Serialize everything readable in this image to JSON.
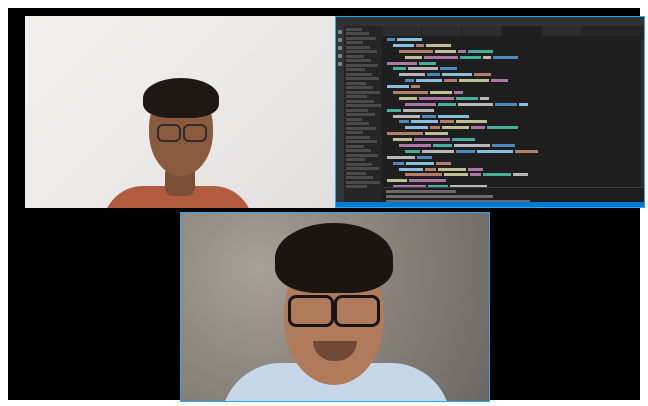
{
  "meeting": {
    "participants": [
      {
        "role": "camera",
        "label": ""
      },
      {
        "role": "screen-share",
        "label": ""
      },
      {
        "role": "camera",
        "label": ""
      }
    ]
  },
  "editor": {
    "title": "",
    "tabs": [
      "",
      "",
      "",
      "",
      ""
    ],
    "active_tab_index": 3,
    "sidebar_rows": 36,
    "code_lines": 26,
    "terminal_lines": 4
  },
  "colors": {
    "stage_background": "#000000",
    "active_speaker_border": "#2aa8ff",
    "editor_background": "#1e1e1e",
    "status_bar": "#007acc"
  }
}
